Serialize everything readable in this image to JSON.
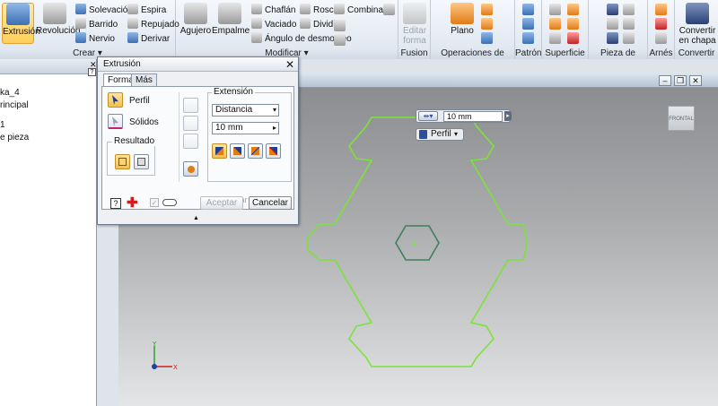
{
  "ribbon": {
    "crear": {
      "title": "Crear",
      "extrusion": "Extrusión",
      "revolucion": "Revolución",
      "solevacion": "Solevación",
      "barrido": "Barrido",
      "nervio": "Nervio",
      "espira": "Espira",
      "repujado": "Repujado",
      "derivar": "Derivar"
    },
    "modificar": {
      "title": "Modificar",
      "agujero": "Agujero",
      "empalme": "Empalme",
      "chaflan": "Chaflán",
      "vaciado": "Vaciado",
      "angulo": "Ángulo de desmoldeo",
      "rosca": "Rosca",
      "dividir": "Dividir",
      "combinar": "Combinar"
    },
    "fusion": {
      "title": "Fusion",
      "editar": "Editar forma"
    },
    "operaciones": {
      "title": "Operaciones de trabajo",
      "plano": "Plano"
    },
    "patron": {
      "title": "Patrón"
    },
    "superficie": {
      "title": "Superficie"
    },
    "plastico": {
      "title": "Pieza de plástico"
    },
    "arnes": {
      "title": "Arnés"
    },
    "convertir": {
      "title": "Convertir",
      "chapa": "Convertir en chapa"
    }
  },
  "browser": {
    "items": [
      "ka_4",
      "rincipal",
      "1",
      "e pieza"
    ]
  },
  "dialog": {
    "title": "Extrusión",
    "tabs": [
      "Forma",
      "Más"
    ],
    "perfil": "Perfil",
    "solidos": "Sólidos",
    "resultado": "Resultado",
    "extension": "Extensión",
    "distancia": "Distancia",
    "distance_value": "10 mm",
    "igualar": "Igualar forma",
    "aceptar": "Aceptar",
    "cancelar": "Cancelar"
  },
  "hud": {
    "distance_value": "10 mm",
    "perfil": "Perfil"
  },
  "viewcube": {
    "label": "FRONTAL"
  },
  "colors": {
    "sketch": "#7be33a",
    "hud_accent": "#2a4f9c"
  }
}
